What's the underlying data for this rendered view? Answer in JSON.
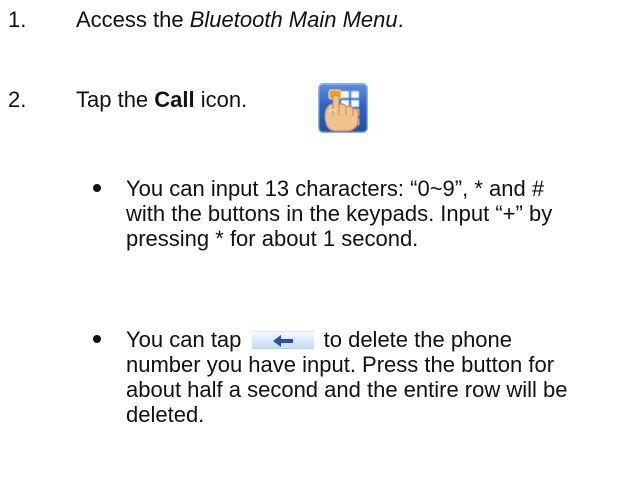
{
  "steps": [
    {
      "number": "1.",
      "text_prefix": "Access the ",
      "text_emphasis": "Bluetooth Main Menu",
      "text_suffix": "."
    },
    {
      "number": "2.",
      "text_prefix": "Tap the ",
      "text_strong": "Call",
      "text_suffix": " icon."
    }
  ],
  "bullets": [
    {
      "text": "You can input 13 characters: “0~9”, * and # with the buttons in the keypads. Input “+” by pressing * for about 1 second."
    },
    {
      "text_before": "You can tap ",
      "text_after": " to delete the phone number you have input. Press the button for about half a second and the entire row will be deleted."
    }
  ],
  "icons": {
    "call_icon": "call-icon",
    "back_arrow": "left-arrow-icon"
  },
  "colors": {
    "text": "#111111",
    "call_icon_background": "#2f63c6",
    "call_icon_hand": "#f0c28d",
    "back_button_background": "#d8e9fb",
    "back_arrow": "#2d4f9f"
  }
}
